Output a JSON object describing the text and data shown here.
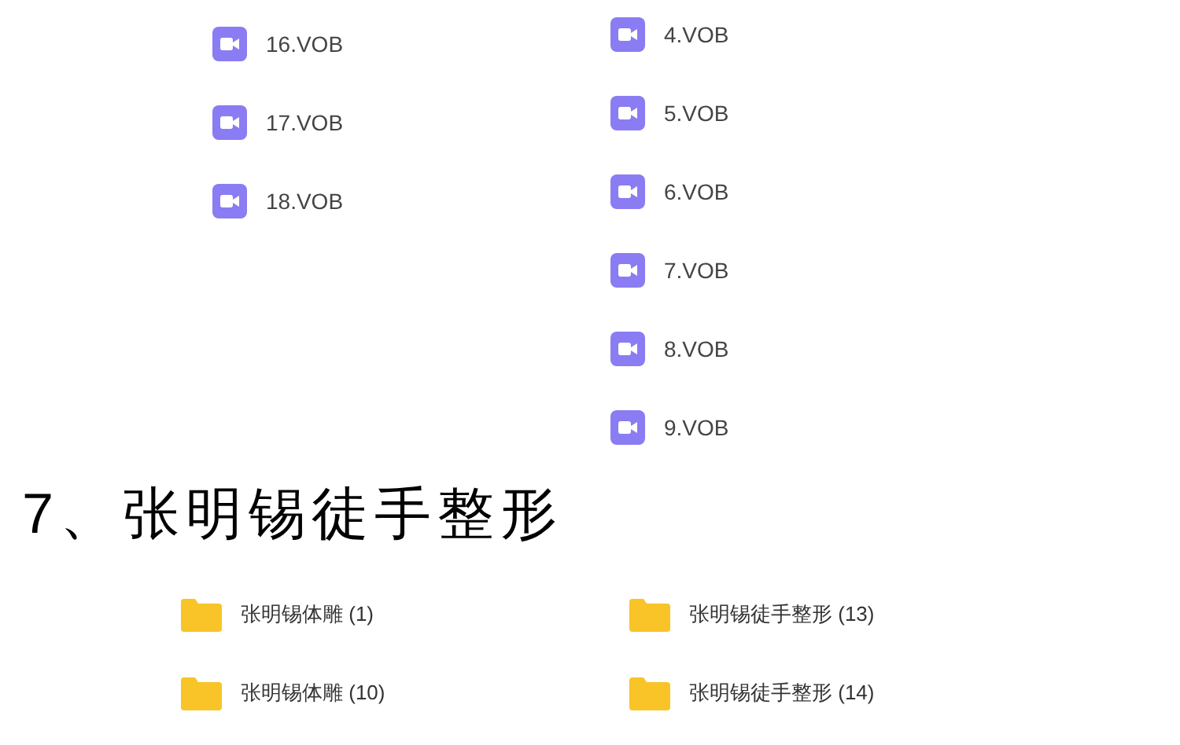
{
  "video_files": {
    "column_1": [
      {
        "kind": "video",
        "name": "16.VOB"
      },
      {
        "kind": "video",
        "name": "17.VOB"
      },
      {
        "kind": "video",
        "name": "18.VOB"
      }
    ],
    "column_2": [
      {
        "kind": "video",
        "name": "4.VOB"
      },
      {
        "kind": "video",
        "name": "5.VOB"
      },
      {
        "kind": "video",
        "name": "6.VOB"
      },
      {
        "kind": "video",
        "name": "7.VOB"
      },
      {
        "kind": "video",
        "name": "8.VOB"
      },
      {
        "kind": "video",
        "name": "9.VOB"
      }
    ]
  },
  "heading": "7、张明锡徒手整形",
  "folders": {
    "column_1": [
      {
        "kind": "folder",
        "name": "张明锡体雕 (1)"
      },
      {
        "kind": "folder",
        "name": "张明锡体雕 (10)"
      }
    ],
    "column_2": [
      {
        "kind": "folder",
        "name": "张明锡徒手整形 (13)"
      },
      {
        "kind": "folder",
        "name": "张明锡徒手整形 (14)"
      }
    ]
  }
}
